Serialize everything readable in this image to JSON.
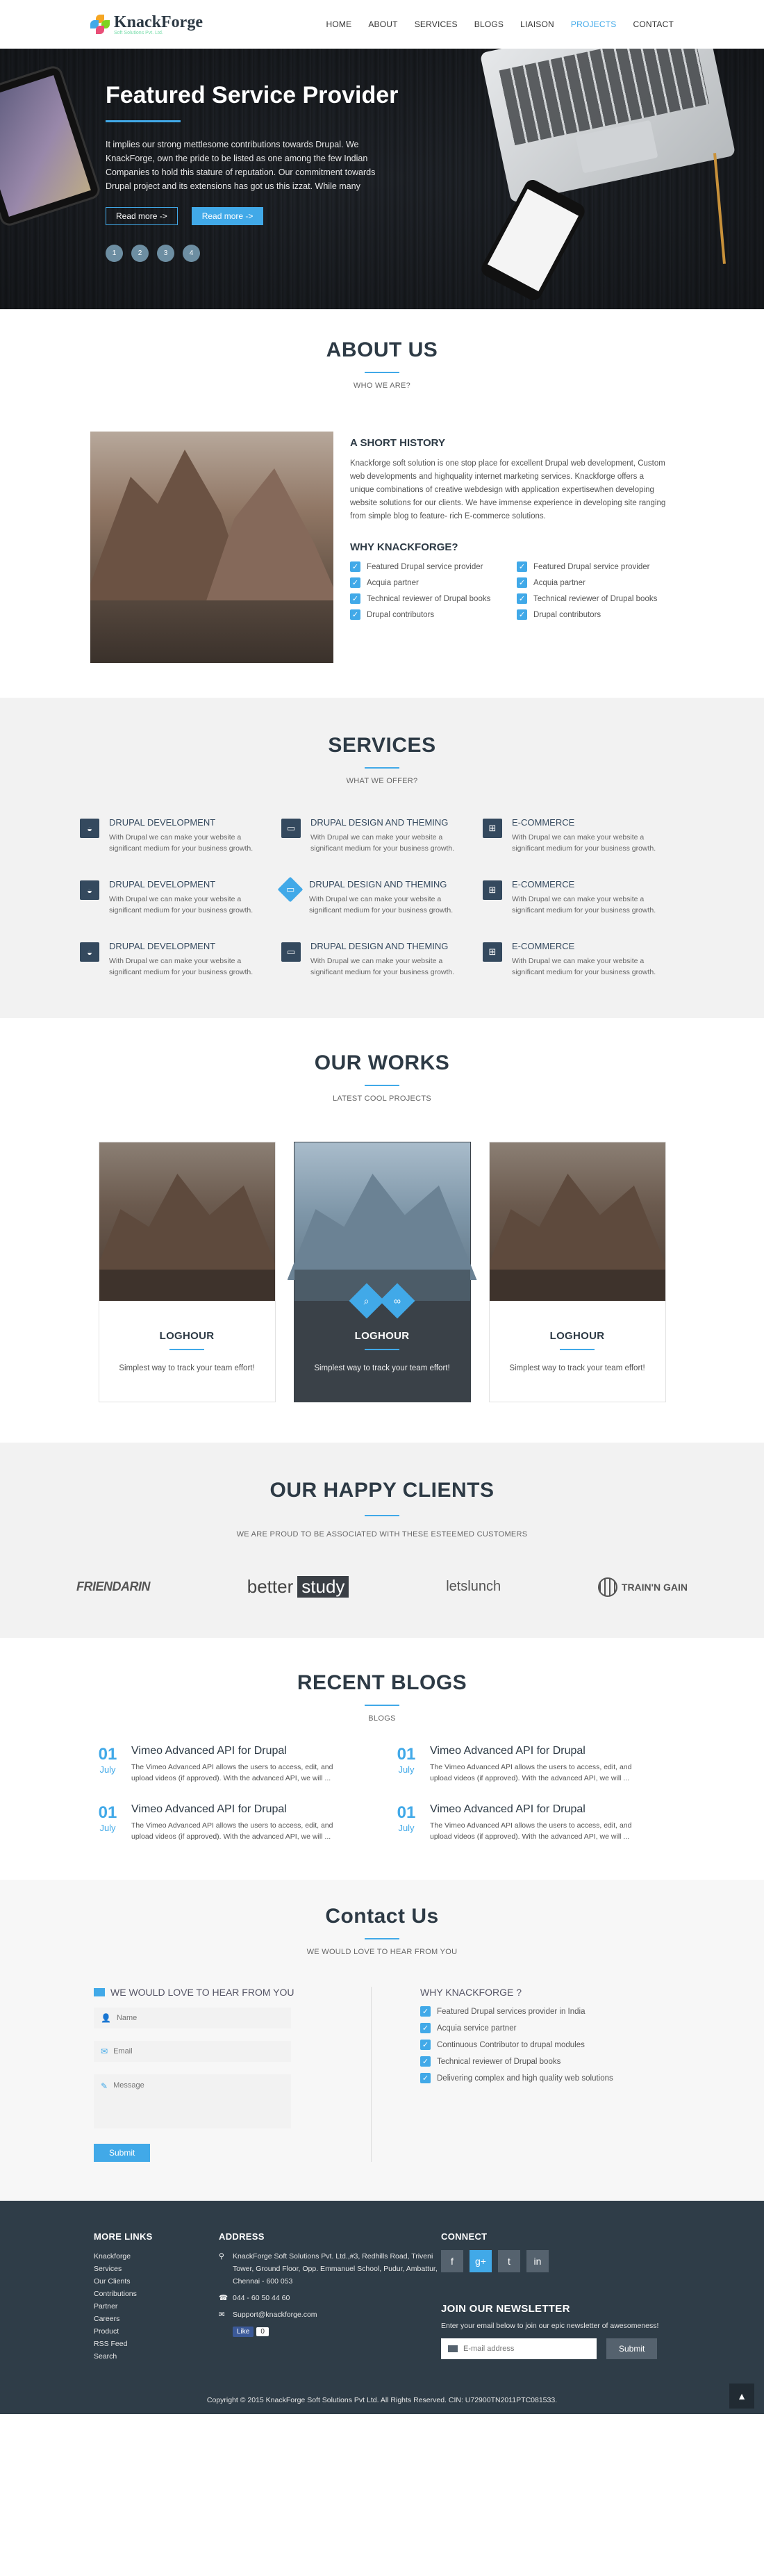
{
  "logo": {
    "name": "KnackForge",
    "tagline": "Soft Solutions Pvt. Ltd."
  },
  "nav": [
    {
      "label": "HOME",
      "active": false
    },
    {
      "label": "ABOUT",
      "active": false
    },
    {
      "label": "SERVICES",
      "active": false
    },
    {
      "label": "BLOGS",
      "active": false
    },
    {
      "label": "LIAISON",
      "active": false
    },
    {
      "label": "PROJECTS",
      "active": true
    },
    {
      "label": "CONTACT",
      "active": false
    }
  ],
  "hero": {
    "title": "Featured Service Provider",
    "text": "It implies our strong mettlesome contributions towards Drupal. We KnackForge, own the pride to be listed as one among the few Indian Companies to hold this stature of reputation. Our commitment towards Drupal project and its extensions has got us this izzat. While many",
    "btn_more_1": "Read more ->",
    "btn_more_2": "Read more ->",
    "dots": [
      "1",
      "2",
      "3",
      "4"
    ]
  },
  "about": {
    "title": "ABOUT US",
    "subtitle": "WHO WE ARE?",
    "history_title": "A SHORT HISTORY",
    "history_text": "Knackforge soft solution is one stop place for excellent Drupal web development, Custom web developments and highquality internet marketing services. Knackforge offers a unique combinations of creative webdesign with application expertisewhen developing website solutions for our clients. We have immense experience in developing site ranging from simple blog to feature- rich E-commerce solutions.",
    "why_title": "WHY KNACKFORGE?",
    "why_items": [
      "Featured Drupal service provider",
      "Featured Drupal service provider",
      "Acquia partner",
      "Acquia partner",
      "Technical reviewer of Drupal books",
      "Technical reviewer of Drupal books",
      "Drupal contributors",
      "Drupal contributors"
    ]
  },
  "services": {
    "title": "SERVICES",
    "subtitle": "WHAT WE OFFER?",
    "items": [
      {
        "title": "DRUPAL DEVELOPMENT",
        "text": "With Drupal we can make your website a significant medium for your business growth.",
        "icon": "drupal-icon"
      },
      {
        "title": "DRUPAL DESIGN AND THEMING",
        "text": "With Drupal we can make your website a significant medium for your business growth.",
        "icon": "monitor-icon"
      },
      {
        "title": "E-COMMERCE",
        "text": "With Drupal we can make your website a significant medium for your business growth.",
        "icon": "cart-icon"
      },
      {
        "title": "DRUPAL DEVELOPMENT",
        "text": "With Drupal we can make your website a significant medium for your business growth.",
        "icon": "drupal-icon"
      },
      {
        "title": "DRUPAL DESIGN AND THEMING",
        "text": "With Drupal we can make your website a significant medium for your business growth.",
        "icon": "monitor-icon"
      },
      {
        "title": "E-COMMERCE",
        "text": "With Drupal we can make your website a significant medium for your business growth.",
        "icon": "cart-icon"
      },
      {
        "title": "DRUPAL DEVELOPMENT",
        "text": "With Drupal we can make your website a significant medium for your business growth.",
        "icon": "drupal-icon"
      },
      {
        "title": "DRUPAL DESIGN AND THEMING",
        "text": "With Drupal we can make your website a significant medium for your business growth.",
        "icon": "monitor-icon"
      },
      {
        "title": "E-COMMERCE",
        "text": "With Drupal we can make your website a significant medium for your business growth.",
        "icon": "cart-icon"
      }
    ]
  },
  "works": {
    "title": "OUR WORKS",
    "subtitle": "LATEST COOL PROJECTS",
    "items": [
      {
        "title": "LOGHOUR",
        "text": "Simplest way to track your team effort!"
      },
      {
        "title": "LOGHOUR",
        "text": "Simplest way to track your team effort!"
      },
      {
        "title": "LOGHOUR",
        "text": "Simplest way to track your team effort!"
      }
    ]
  },
  "clients": {
    "title": "OUR HAPPY CLIENTS",
    "subtitle": "WE ARE PROUD TO BE ASSOCIATED WITH THESE ESTEEMED CUSTOMERS",
    "logos": {
      "friendarin": "FRIENDARIN",
      "better": "better",
      "study": "study",
      "letslunch": "letslunch",
      "traingain": "TRAIN'N GAIN"
    }
  },
  "blogs": {
    "title": "RECENT BLOGS",
    "subtitle": "BLOGS",
    "items": [
      {
        "day": "01",
        "month": "July",
        "title": "Vimeo Advanced API for Drupal",
        "text": "The Vimeo Advanced API allows the users to access, edit, and upload videos (if approved). With the advanced API, we will ..."
      },
      {
        "day": "01",
        "month": "July",
        "title": "Vimeo Advanced API for Drupal",
        "text": "The Vimeo Advanced API allows the users to access, edit, and upload videos (if approved). With the advanced API, we will ..."
      },
      {
        "day": "01",
        "month": "July",
        "title": "Vimeo Advanced API for Drupal",
        "text": "The Vimeo Advanced API allows the users to access, edit, and upload videos (if approved). With the advanced API, we will ..."
      },
      {
        "day": "01",
        "month": "July",
        "title": "Vimeo Advanced API for Drupal",
        "text": "The Vimeo Advanced API allows the users to access, edit, and upload videos (if approved). With the advanced API, we will ..."
      }
    ]
  },
  "contact": {
    "title": "Contact Us",
    "subtitle": "WE WOULD LOVE TO HEAR FROM YOU",
    "form_title": "WE WOULD LOVE TO HEAR FROM YOU",
    "name_placeholder": "Name",
    "email_placeholder": "Email",
    "message_placeholder": "Message",
    "submit": "Submit",
    "why_title": "WHY KNACKFORGE ?",
    "why_items": [
      "Featured Drupal services provider in India",
      "Acquia service partner",
      "Continuous Contributor to drupal modules",
      "Technical reviewer of Drupal books",
      "Delivering complex and high quality web solutions"
    ]
  },
  "footer": {
    "links_title": "MORE LINKS",
    "links": [
      "Knackforge",
      "Services",
      "Our Clients",
      "Contributions",
      "Partner",
      "Careers",
      "Product",
      "RSS Feed",
      "Search"
    ],
    "address_title": "ADDRESS",
    "address": "KnackForge Soft Solutions Pvt. Ltd.,#3, Redhills Road, Triveni Tower, Ground Floor, Opp. Emmanuel School, Pudur, Ambattur, Chennai - 600 053",
    "phone": "044 - 60 50 44 60",
    "email": "Support@knackforge.com",
    "like_label": "Like",
    "like_count": "0",
    "connect_title": "CONNECT",
    "socials": [
      {
        "label": "f",
        "icon": "facebook-icon",
        "active": false
      },
      {
        "label": "g+",
        "icon": "google-plus-icon",
        "active": true
      },
      {
        "label": "t",
        "icon": "twitter-icon",
        "active": false
      },
      {
        "label": "in",
        "icon": "linkedin-icon",
        "active": false
      }
    ],
    "newsletter_title": "JOIN OUR NEWSLETTER",
    "newsletter_text": "Enter your email below to join our epic newsletter of awesomeness!",
    "newsletter_placeholder": "E-mail address",
    "newsletter_submit": "Submit",
    "copyright": "Copyright © 2015 KnackForge Soft Solutions Pvt Ltd. All Rights Reserved. CIN: U72900TN2011PTC081533."
  },
  "colors": {
    "accent": "#41a9e8",
    "dark": "#2d3a45",
    "footer": "#2f3d48",
    "icon_bg": "#34495e"
  }
}
